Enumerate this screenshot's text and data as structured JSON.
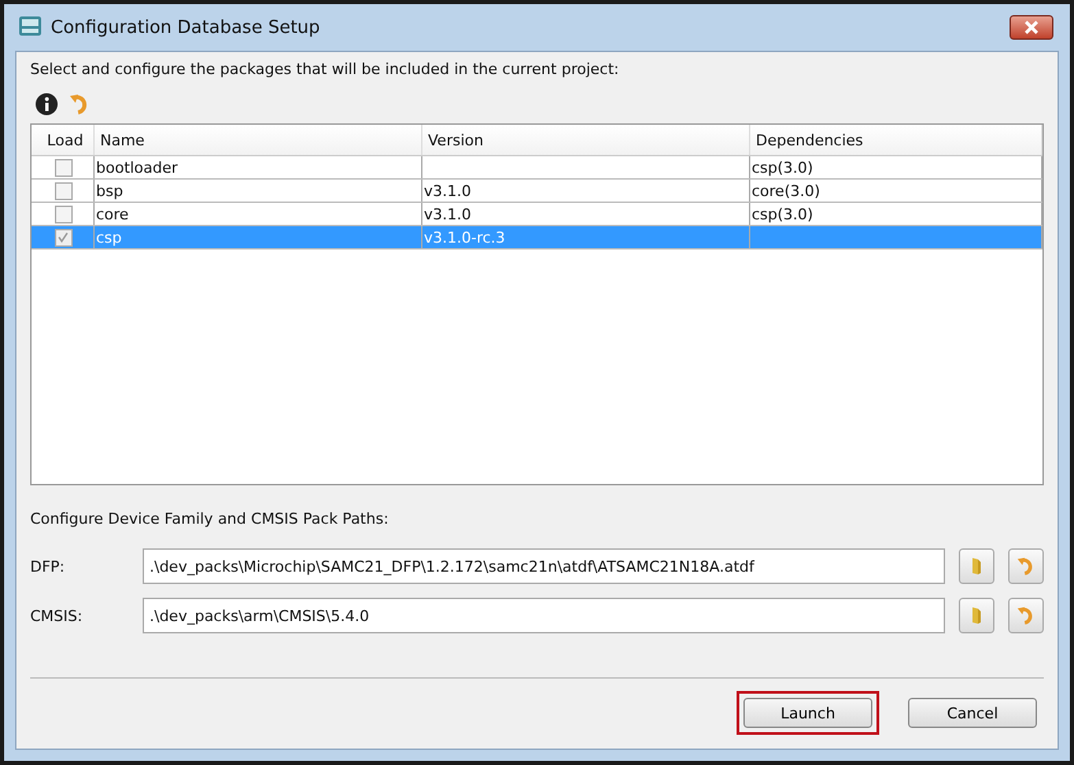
{
  "window": {
    "title": "Configuration Database Setup"
  },
  "instructions": "Select and configure the packages that will be included in the current project:",
  "table": {
    "columns": [
      "Load",
      "Name",
      "Version",
      "Dependencies"
    ],
    "rows": [
      {
        "checked": false,
        "selected": false,
        "name": "bootloader",
        "version": "",
        "dependencies": "csp(3.0)"
      },
      {
        "checked": false,
        "selected": false,
        "name": "bsp",
        "version": "v3.1.0",
        "dependencies": "core(3.0)"
      },
      {
        "checked": false,
        "selected": false,
        "name": "core",
        "version": "v3.1.0",
        "dependencies": "csp(3.0)"
      },
      {
        "checked": true,
        "selected": true,
        "name": "csp",
        "version": "v3.1.0-rc.3",
        "dependencies": ""
      }
    ]
  },
  "paths": {
    "heading": "Configure Device Family and CMSIS Pack Paths:",
    "fields": [
      {
        "label": "DFP:",
        "value": ".\\dev_packs\\Microchip\\SAMC21_DFP\\1.2.172\\samc21n\\atdf\\ATSAMC21N18A.atdf"
      },
      {
        "label": "CMSIS:",
        "value": ".\\dev_packs\\arm\\CMSIS\\5.4.0"
      }
    ]
  },
  "buttons": [
    {
      "label": "Launch",
      "highlighted": true
    },
    {
      "label": "Cancel",
      "highlighted": false
    }
  ]
}
